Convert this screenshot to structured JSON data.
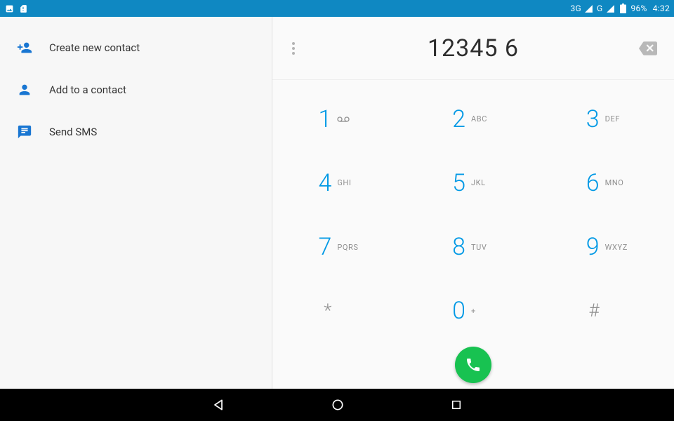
{
  "status": {
    "network_label": "3G",
    "signal_label_g": "G",
    "battery_pct": "96%",
    "time": "4:32"
  },
  "sidebar": {
    "items": [
      {
        "label": "Create new contact"
      },
      {
        "label": "Add to a contact"
      },
      {
        "label": "Send SMS"
      }
    ]
  },
  "dialer": {
    "display": "12345 6",
    "keys": {
      "k1": {
        "digit": "1",
        "sub": ""
      },
      "k2": {
        "digit": "2",
        "sub": "ABC"
      },
      "k3": {
        "digit": "3",
        "sub": "DEF"
      },
      "k4": {
        "digit": "4",
        "sub": "GHI"
      },
      "k5": {
        "digit": "5",
        "sub": "JKL"
      },
      "k6": {
        "digit": "6",
        "sub": "MNO"
      },
      "k7": {
        "digit": "7",
        "sub": "PQRS"
      },
      "k8": {
        "digit": "8",
        "sub": "TUV"
      },
      "k9": {
        "digit": "9",
        "sub": "WXYZ"
      },
      "kstar": {
        "digit": "*",
        "sub": ""
      },
      "k0": {
        "digit": "0",
        "sub": "+"
      },
      "khash": {
        "digit": "#",
        "sub": ""
      }
    }
  },
  "colors": {
    "status_bar": "#0f88c2",
    "accent_blue": "#0099e5",
    "icon_blue": "#1976d2",
    "call_green": "#18c251",
    "text_dark": "#2e2e2e",
    "text_grey": "#8f8f8f"
  }
}
